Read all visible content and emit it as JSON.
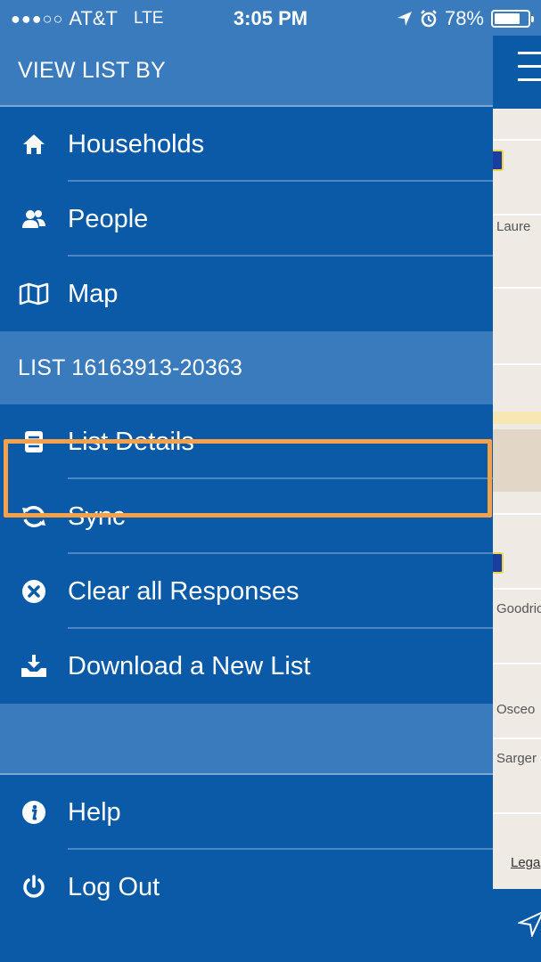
{
  "status_bar": {
    "signal": "●●●○○",
    "carrier": "AT&T",
    "network": "LTE",
    "time": "3:05 PM",
    "battery": "78%",
    "battery_level": 0.78
  },
  "drawer": {
    "view_list_by_header": "VIEW LIST BY",
    "view_items": [
      {
        "label": "Households",
        "icon": "home-icon"
      },
      {
        "label": "People",
        "icon": "people-icon"
      },
      {
        "label": "Map",
        "icon": "map-icon"
      }
    ],
    "list_header": "LIST 16163913-20363",
    "list_items": [
      {
        "label": "List Details",
        "icon": "document-icon"
      },
      {
        "label": "Sync",
        "icon": "sync-icon",
        "highlighted": true
      },
      {
        "label": "Clear all Responses",
        "icon": "clear-icon"
      },
      {
        "label": "Download a New List",
        "icon": "download-icon"
      }
    ],
    "bottom_items": [
      {
        "label": "Help",
        "icon": "info-icon"
      },
      {
        "label": "Log Out",
        "icon": "power-icon"
      }
    ]
  },
  "map_peek": {
    "labels": [
      "Laure",
      "Goodric",
      "Osceo",
      "Sarger"
    ],
    "legal": "Lega"
  },
  "colors": {
    "drawer_bg": "#0a5aa8",
    "header_bg": "#3a7bbd",
    "highlight": "#f5a04a"
  }
}
